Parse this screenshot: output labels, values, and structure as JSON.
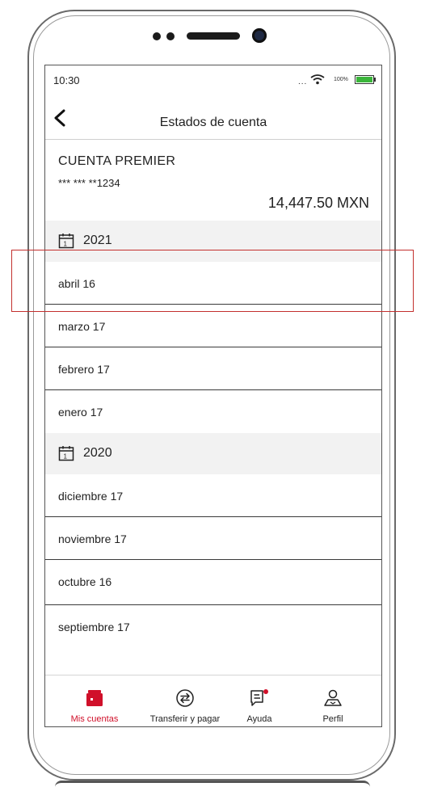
{
  "status_bar": {
    "time": "10:30",
    "signal_dots": "...",
    "battery_pct": "100%"
  },
  "header": {
    "title": "Estados de cuenta"
  },
  "account": {
    "name": "CUENTA PREMIER",
    "number": "*** *** **1234",
    "balance": "14,447.50 MXN"
  },
  "statements": [
    {
      "year": "2021",
      "months": [
        "abril 16",
        "marzo 17",
        "febrero 17",
        "enero  17"
      ]
    },
    {
      "year": "2020",
      "months": [
        "diciembre 17",
        "noviembre 17",
        "octubre 16",
        "septiembre 17"
      ]
    }
  ],
  "tabs": [
    {
      "label": "Mis cuentas",
      "icon": "wallet-icon",
      "active": true
    },
    {
      "label": "Transferir y pagar",
      "icon": "transfer-icon",
      "active": false
    },
    {
      "label": "Ayuda",
      "icon": "help-chat-icon",
      "active": false
    },
    {
      "label": "Perfil",
      "icon": "profile-icon",
      "active": false
    }
  ],
  "colors": {
    "accent": "#d0102a",
    "highlight": "#c3302e",
    "year_bg": "#f2f2f2",
    "battery": "#3bb53b"
  }
}
